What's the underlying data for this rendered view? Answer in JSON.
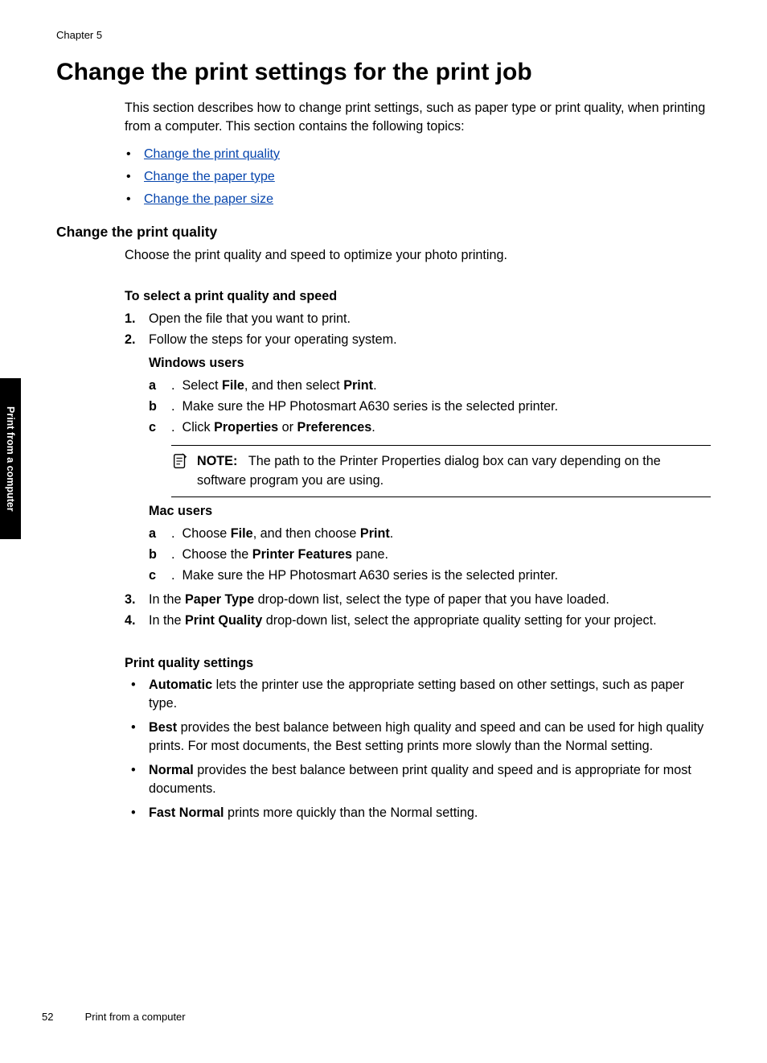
{
  "chapter": "Chapter 5",
  "heading": "Change the print settings for the print job",
  "intro": "This section describes how to change print settings, such as paper type or print quality, when printing from a computer. This section contains the following topics:",
  "toc": {
    "item1": "Change the print quality",
    "item2": "Change the paper type",
    "item3": "Change the paper size"
  },
  "subheading": "Change the print quality",
  "choose_para": "Choose the print quality and speed to optimize your photo printing.",
  "select_heading": "To select a print quality and speed",
  "step1": "Open the file that you want to print.",
  "step2": "Follow the steps for your operating system.",
  "windows_heading": "Windows users",
  "win_a_pre": "Select ",
  "win_a_file": "File",
  "win_a_mid": ", and then select ",
  "win_a_print": "Print",
  "win_a_post": ".",
  "win_b": "Make sure the HP Photosmart A630 series is the selected printer.",
  "win_c_pre": "Click ",
  "win_c_prop": "Properties",
  "win_c_or": " or ",
  "win_c_pref": "Preferences",
  "win_c_post": ".",
  "note_label": "NOTE:",
  "note_text": "The path to the Printer Properties dialog box can vary depending on the software program you are using.",
  "mac_heading": "Mac users",
  "mac_a_pre": "Choose ",
  "mac_a_file": "File",
  "mac_a_mid": ", and then choose ",
  "mac_a_print": "Print",
  "mac_a_post": ".",
  "mac_b_pre": "Choose the ",
  "mac_b_pf": "Printer Features",
  "mac_b_post": " pane.",
  "mac_c": "Make sure the HP Photosmart A630 series is the selected printer.",
  "step3_pre": "In the ",
  "step3_bold": "Paper Type",
  "step3_post": " drop-down list, select the type of paper that you have loaded.",
  "step4_pre": "In the ",
  "step4_bold": "Print Quality",
  "step4_post": " drop-down list, select the appropriate quality setting for your project.",
  "quality_heading": "Print quality settings",
  "q_auto_bold": "Automatic",
  "q_auto_text": " lets the printer use the appropriate setting based on other settings, such as paper type.",
  "q_best_bold": "Best",
  "q_best_text": " provides the best balance between high quality and speed and can be used for high quality prints. For most documents, the Best setting prints more slowly than the Normal setting.",
  "q_normal_bold": "Normal",
  "q_normal_text": " provides the best balance between print quality and speed and is appropriate for most documents.",
  "q_fast_bold": "Fast Normal",
  "q_fast_text": " prints more quickly than the Normal setting.",
  "side_tab": "Print from a computer",
  "footer_page": "52",
  "footer_text": "Print from a computer"
}
